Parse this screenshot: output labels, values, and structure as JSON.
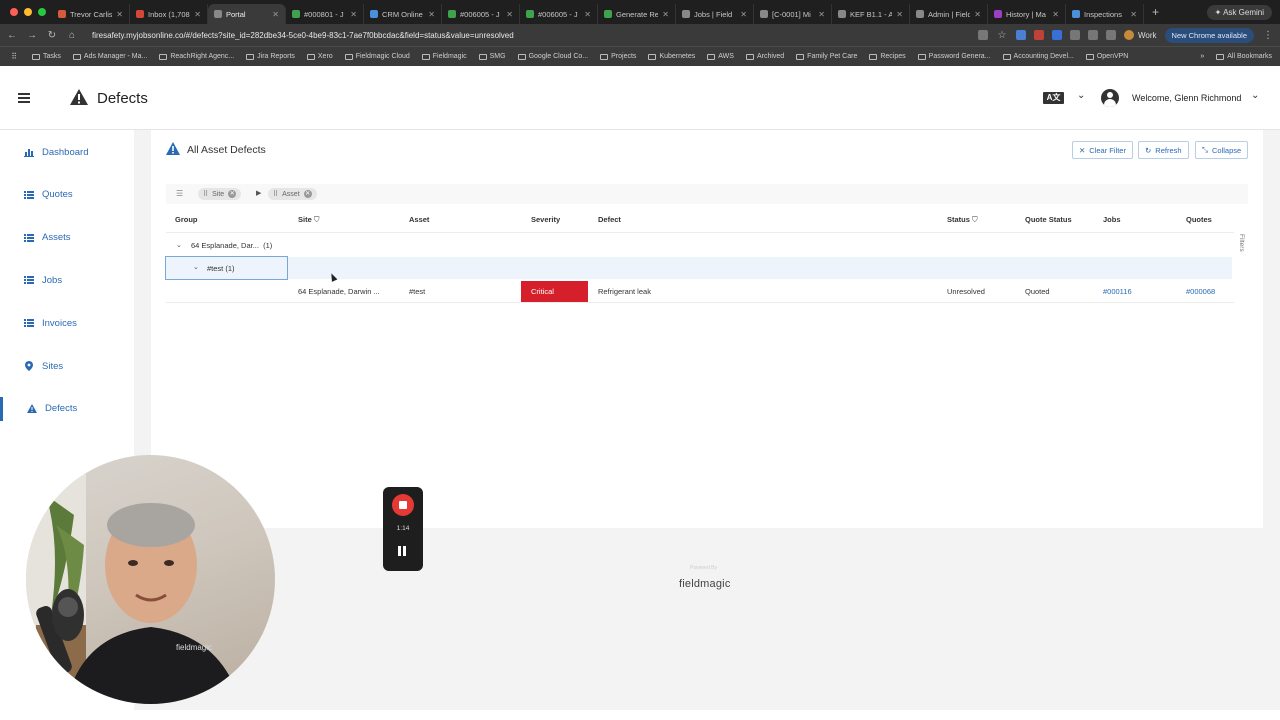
{
  "browser": {
    "tabs": [
      {
        "label": "Trevor Carlis",
        "color": "#d65b3a"
      },
      {
        "label": "Inbox (1,708)",
        "color": "#d44638"
      },
      {
        "label": "Portal",
        "color": "#888888"
      },
      {
        "label": "#000801 - J",
        "color": "#3fa34d"
      },
      {
        "label": "CRM Online",
        "color": "#4a90d9"
      },
      {
        "label": "#006005 - J",
        "color": "#3fa34d"
      },
      {
        "label": "#006005 - J",
        "color": "#3fa34d"
      },
      {
        "label": "Generate Re",
        "color": "#3fa34d"
      },
      {
        "label": "Jobs | Field",
        "color": "#888888"
      },
      {
        "label": "[C-0001] Mi",
        "color": "#888888"
      },
      {
        "label": "KEF B1.1 - A",
        "color": "#888888"
      },
      {
        "label": "Admin | Field",
        "color": "#888888"
      },
      {
        "label": "History | Ma",
        "color": "#9c3fc0"
      },
      {
        "label": "Inspections",
        "color": "#4a90d9"
      }
    ],
    "ask_gemini": "Ask Gemini",
    "url": "firesafety.myjobsonline.co/#/defects?site_id=282dbe34-5ce0-4be9-83c1-7ae7f0bbcdac&field=status&value=unresolved",
    "profile": "Work",
    "chrome_available": "New Chrome available",
    "bookmarks": [
      "Tasks",
      "Ads Manager - Ma...",
      "ReachRight Agenc...",
      "Jira Reports",
      "Xero",
      "Fieldmagic Cloud",
      "Fieldmagic",
      "SMG",
      "Google Cloud Co...",
      "Projects",
      "Kubernetes",
      "AWS",
      "Archived",
      "Family Pet Care",
      "Recipes",
      "Password Genera...",
      "Accounting Devel...",
      "OpenVPN"
    ],
    "all_bookmarks": "All Bookmarks"
  },
  "header": {
    "title": "Defects",
    "welcome": "Welcome, Glenn Richmond",
    "lang_icon": "A文"
  },
  "sidebar": {
    "items": [
      {
        "label": "Dashboard",
        "icon": "bar-chart-icon"
      },
      {
        "label": "Quotes",
        "icon": "list-icon"
      },
      {
        "label": "Assets",
        "icon": "list-icon"
      },
      {
        "label": "Jobs",
        "icon": "list-icon"
      },
      {
        "label": "Invoices",
        "icon": "list-icon"
      },
      {
        "label": "Sites",
        "icon": "map-pin-icon"
      },
      {
        "label": "Defects",
        "icon": "warning-icon"
      }
    ],
    "active": "Defects"
  },
  "main": {
    "title": "All Asset Defects",
    "buttons": {
      "clear_filter": "Clear Filter",
      "refresh": "Refresh",
      "collapse": "Collapse"
    },
    "group_chips": [
      "Site",
      "Asset"
    ],
    "columns": [
      "Group",
      "Site",
      "Asset",
      "Severity",
      "Defect",
      "Status",
      "Quote Status",
      "Jobs",
      "Quotes"
    ],
    "groups": [
      {
        "label": "64 Esplanade, Dar...",
        "count": "(1)"
      },
      {
        "label": "#test (1)"
      }
    ],
    "rows": [
      {
        "site": "64 Esplanade, Darwin ...",
        "asset": "#test",
        "severity": "Critical",
        "defect": "Refrigerant leak",
        "status": "Unresolved",
        "quote_status": "Quoted",
        "job": "#000116",
        "quote": "#000068"
      }
    ],
    "filters_label": "Filters"
  },
  "footer": {
    "powered_by": "Powered By",
    "logo": "fieldmagic"
  },
  "recorder": {
    "time": "1:14"
  },
  "colors": {
    "accent": "#2a6ab4",
    "critical": "#d5202c"
  }
}
